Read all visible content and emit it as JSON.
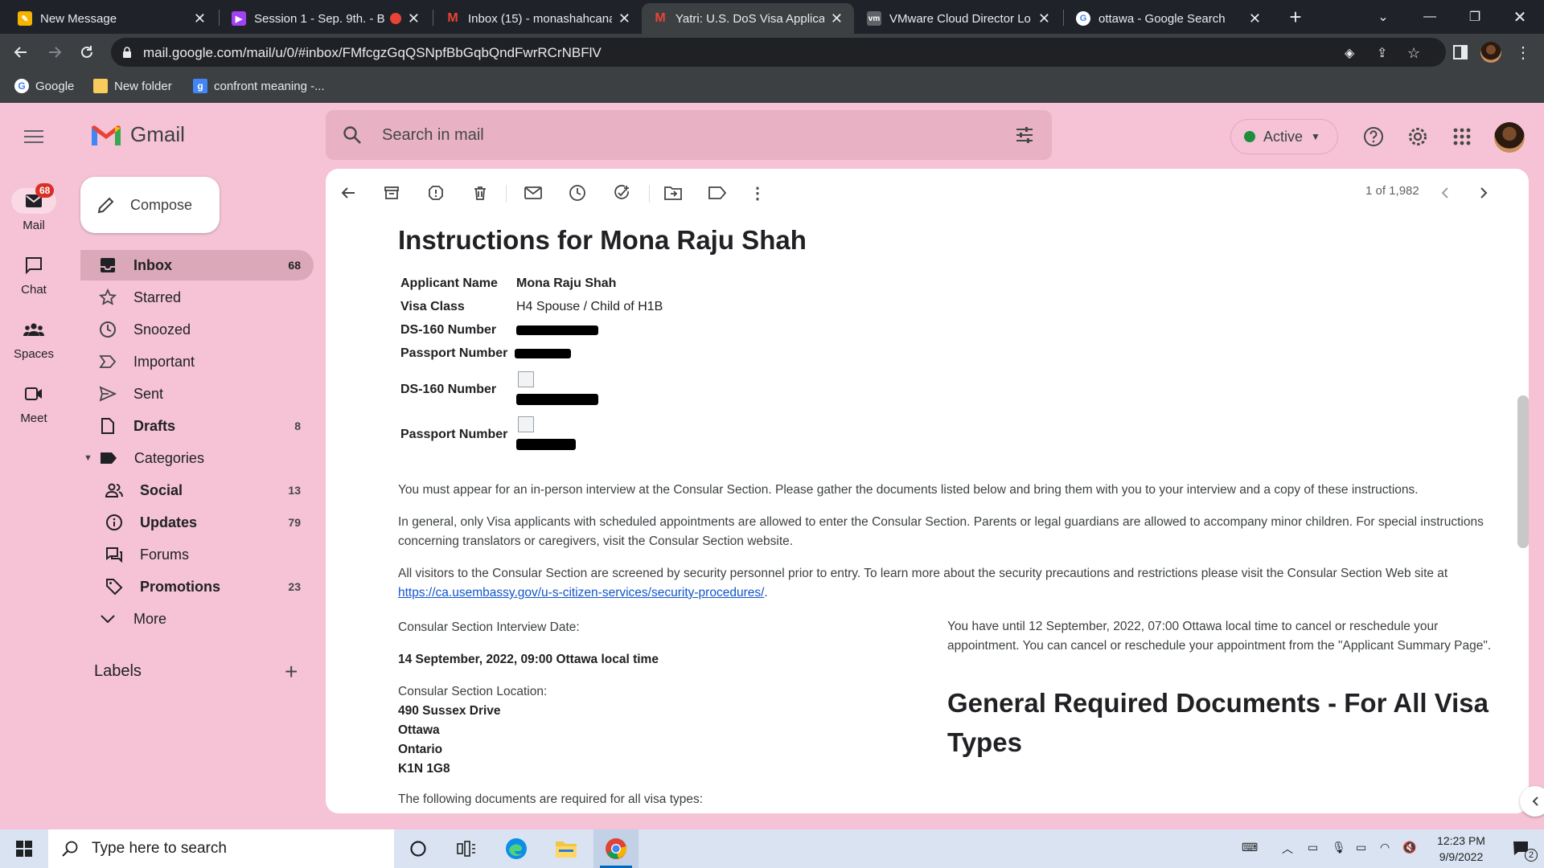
{
  "browser": {
    "tabs": [
      {
        "title": "New Message",
        "favicon": "pencil-icon"
      },
      {
        "title": "Session 1 - Sep. 9th. - B",
        "favicon": "media-icon"
      },
      {
        "title": "Inbox (15) - monashahcana",
        "favicon": "gmail-icon"
      },
      {
        "title": "Yatri: U.S. DoS Visa Applicat",
        "favicon": "gmail-icon"
      },
      {
        "title": "VMware Cloud Director Lo",
        "favicon": "vmware-icon"
      },
      {
        "title": "ottawa - Google Search",
        "favicon": "google-icon"
      }
    ],
    "active_tab": 3,
    "url": "mail.google.com/mail/u/0/#inbox/FMfcgzGqQSNpfBbGqbQndFwrRCrNBFlV",
    "bookmarks": [
      "Google",
      "New folder",
      "confront meaning -..."
    ]
  },
  "gmail": {
    "brand": "Gmail",
    "search_placeholder": "Search in mail",
    "status": "Active",
    "rail": [
      {
        "label": "Mail",
        "badge": "68"
      },
      {
        "label": "Chat"
      },
      {
        "label": "Spaces"
      },
      {
        "label": "Meet"
      }
    ],
    "compose_label": "Compose",
    "nav": [
      {
        "label": "Inbox",
        "count": "68"
      },
      {
        "label": "Starred",
        "count": ""
      },
      {
        "label": "Snoozed",
        "count": ""
      },
      {
        "label": "Important",
        "count": ""
      },
      {
        "label": "Sent",
        "count": ""
      },
      {
        "label": "Drafts",
        "count": "8"
      },
      {
        "label": "Categories",
        "count": ""
      },
      {
        "label": "Social",
        "count": "13"
      },
      {
        "label": "Updates",
        "count": "79"
      },
      {
        "label": "Forums",
        "count": ""
      },
      {
        "label": "Promotions",
        "count": "23"
      },
      {
        "label": "More",
        "count": ""
      }
    ],
    "labels_heading": "Labels",
    "pager": "1 of 1,982"
  },
  "email": {
    "heading": "Instructions for Mona Raju Shah",
    "fields": [
      {
        "label": "Applicant Name",
        "value": "Mona Raju Shah"
      },
      {
        "label": "Visa Class",
        "value": "H4 Spouse / Child of H1B"
      },
      {
        "label": "DS-160 Number",
        "value": ""
      },
      {
        "label": "Passport Number",
        "value": ""
      },
      {
        "label": "DS-160 Number",
        "value": ""
      },
      {
        "label": "Passport Number",
        "value": ""
      }
    ],
    "para1": "You must appear for an in-person interview at the Consular Section. Please gather the documents listed below and bring them with you to your interview and a copy of these instructions.",
    "para2": "In general, only Visa applicants with scheduled appointments are allowed to enter the Consular Section. Parents or legal guardians are allowed to accompany minor children. For special instructions concerning translators or caregivers, visit the Consular Section website.",
    "para3": "All visitors to the Consular Section are screened by security personnel prior to entry. To learn more about the security precautions and restrictions please visit the Consular Section Web site at",
    "para3_link": "https://ca.usembassy.gov/u-s-citizen-services/security-procedures/",
    "interview_date_label": "Consular Section Interview Date:",
    "interview_date": "14 September, 2022, 09:00 Ottawa local time",
    "location_label": "Consular Section Location:",
    "location_lines": [
      "490 Sussex Drive",
      "Ottawa",
      "Ontario",
      "K1N 1G8"
    ],
    "required_docs_intro": "The following documents are required for all visa types:",
    "cancel_note": "You have until 12 September, 2022, 07:00 Ottawa local time to cancel or reschedule your appointment. You can cancel or reschedule your appointment from the \"Applicant Summary Page\".",
    "docs_heading": "General Required Documents - For All Visa Types"
  },
  "taskbar": {
    "search_placeholder": "Type here to search",
    "time": "12:23 PM",
    "date": "9/9/2022",
    "notifications": "2"
  },
  "colors": {
    "theme_bg": "#f5c3d5",
    "active_nav": "#dba8b9",
    "status_green": "#1e8e3e",
    "badge_red": "#d93025",
    "link": "#1155cc"
  }
}
